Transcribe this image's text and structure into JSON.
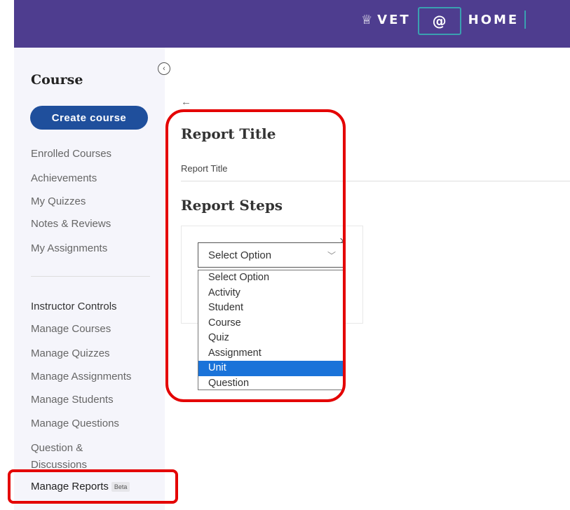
{
  "header": {
    "logo_hat": "♕",
    "logo_vet": "VET",
    "logo_at": "@",
    "logo_home": "HOME"
  },
  "sidebar": {
    "collapse_icon": "chevron-left-icon",
    "title": "Course",
    "create_button": "Create course",
    "items": [
      {
        "label": "Enrolled Courses"
      },
      {
        "label": "Achievements"
      },
      {
        "label": "My Quizzes"
      },
      {
        "label": "Notes & Reviews"
      },
      {
        "label": "My Assignments"
      }
    ],
    "instructor_label": "Instructor Controls",
    "instructor_items": [
      {
        "label": "Manage Courses"
      },
      {
        "label": "Manage Quizzes"
      },
      {
        "label": "Manage Assignments"
      },
      {
        "label": "Manage Students"
      },
      {
        "label": "Manage Questions"
      },
      {
        "label": "Question & Discussions"
      }
    ],
    "manage_reports": "Manage Reports",
    "beta_badge": "Beta"
  },
  "main": {
    "back_icon": "←",
    "report_title_heading": "Report Title",
    "report_title_label": "Report Title",
    "report_steps_heading": "Report Steps",
    "close_icon": "×",
    "select_value": "Select Option",
    "select_chevron": "﹀",
    "options": [
      "Select Option",
      "Activity",
      "Student",
      "Course",
      "Quiz",
      "Assignment",
      "Unit",
      "Question"
    ],
    "selected_option": "Unit"
  },
  "colors": {
    "header_bg": "#4e3d8f",
    "button_bg": "#1f4f9c",
    "highlight": "#e40000",
    "option_selected": "#1a73d9"
  }
}
